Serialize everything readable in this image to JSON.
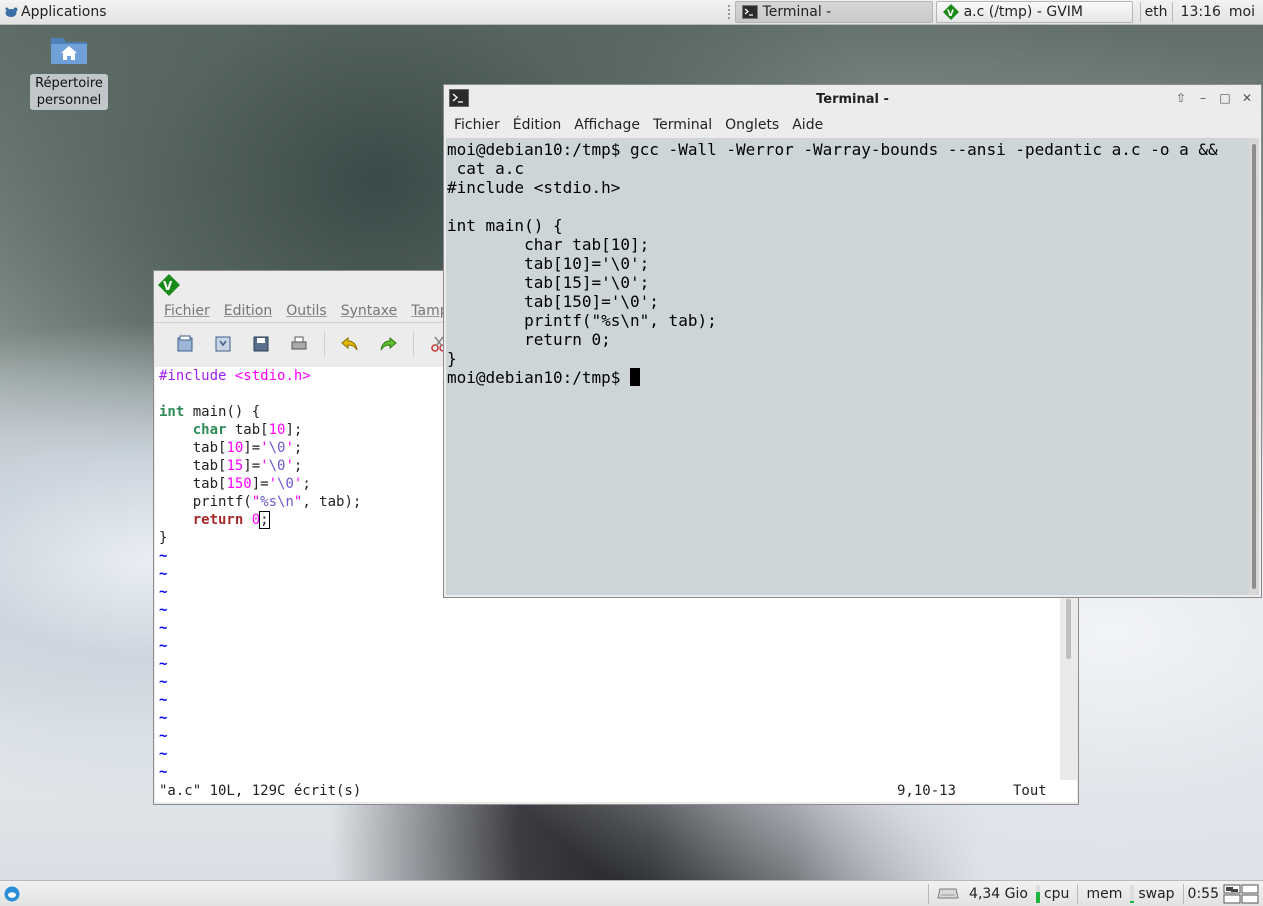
{
  "top_panel": {
    "apps_label": "Applications",
    "tasks": [
      {
        "label": "Terminal -",
        "active": true
      },
      {
        "label": "a.c (/tmp) - GVIM",
        "active": false
      }
    ],
    "net": "eth",
    "clock": "13:16",
    "user": "moi"
  },
  "desktop": {
    "home_label_1": "Répertoire",
    "home_label_2": "personnel"
  },
  "gvim": {
    "menu": [
      "Fichier",
      "Edition",
      "Outils",
      "Syntaxe",
      "Tamp"
    ],
    "code": {
      "include_kw": "#include",
      "include_file": "<stdio.h>",
      "int_kw": "int",
      "main_sig": " main() {",
      "char_kw": "char",
      "decl_name": " tab[",
      "n10": "10",
      "n15": "15",
      "n150": "150",
      "n0": "0",
      "tab_open": "tab[",
      "assign_close": "]=",
      "nulchar_open": "'",
      "nulchar_esc": "\\0",
      "nulchar_close": "'",
      "semi": ";",
      "bracket_semi": "];",
      "printf_open": "printf(",
      "fmt_q1": "\"",
      "fmt_s": "%s",
      "fmt_n": "\\n",
      "fmt_q2": "\"",
      "printf_rest": ", tab);",
      "return_kw": "return",
      "close_brace": "}",
      "tilde": "~"
    },
    "status_msg": "\"a.c\" 10L, 129C écrit(s)",
    "status_pos": "9,10-13",
    "status_all": "Tout"
  },
  "terminal": {
    "title": "Terminal -",
    "menu": [
      "Fichier",
      "Édition",
      "Affichage",
      "Terminal",
      "Onglets",
      "Aide"
    ],
    "lines": [
      "moi@debian10:/tmp$ gcc -Wall -Werror -Warray-bounds --ansi -pedantic a.c -o a &&",
      " cat a.c",
      "#include <stdio.h>",
      "",
      "int main() {",
      "        char tab[10];",
      "        tab[10]='\\0';",
      "        tab[15]='\\0';",
      "        tab[150]='\\0';",
      "        printf(\"%s\\n\", tab);",
      "        return 0;",
      "}"
    ],
    "prompt": "moi@debian10:/tmp$ "
  },
  "bottom_panel": {
    "storage": "4,34 Gio",
    "cpu": "cpu",
    "mem": "mem",
    "swap": "swap",
    "timer": "0:55"
  },
  "meters": {
    "cpu": 0.6,
    "mem": 0.1,
    "swap": 0.0
  }
}
